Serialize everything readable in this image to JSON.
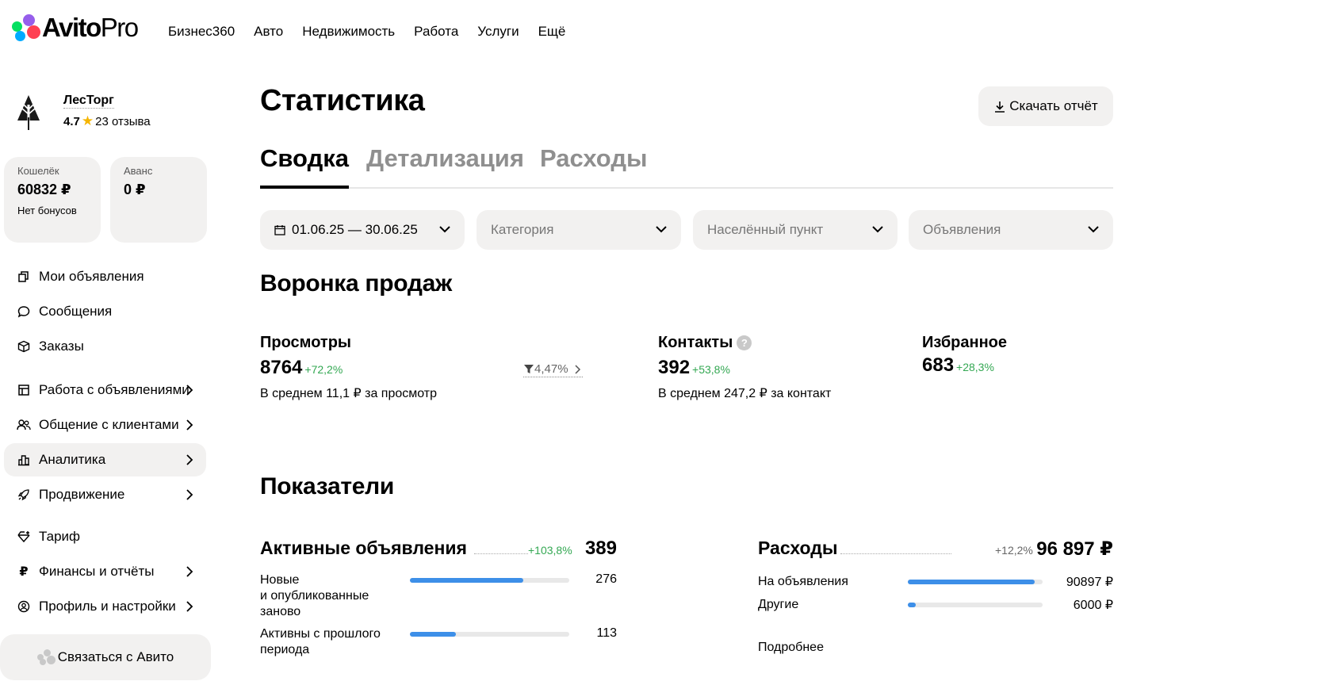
{
  "header": {
    "logo": {
      "avito": "Avito",
      "pro": "Pro"
    },
    "nav": [
      "Бизнес360",
      "Авто",
      "Недвижимость",
      "Работа",
      "Услуги",
      "Ещё"
    ]
  },
  "company": {
    "name": "ЛесТорг",
    "rating": "4.7",
    "reviews": "23 отзыва"
  },
  "wallets": [
    {
      "label": "Кошелёк",
      "value": "60832 ₽",
      "sub": "Нет бонусов"
    },
    {
      "label": "Аванс",
      "value": "0 ₽",
      "sub": ""
    }
  ],
  "menu": [
    {
      "label": "Мои объявления",
      "icon": "copy-icon",
      "chevron": false,
      "active": false
    },
    {
      "label": "Сообщения",
      "icon": "chat-icon",
      "chevron": false,
      "active": false
    },
    {
      "label": "Заказы",
      "icon": "box-icon",
      "chevron": false,
      "active": false
    },
    {
      "label": "Работа с объявлениями",
      "icon": "layout-icon",
      "chevron": true,
      "active": false
    },
    {
      "label": "Общение с клиентами",
      "icon": "users-icon",
      "chevron": true,
      "active": false
    },
    {
      "label": "Аналитика",
      "icon": "bar-chart-icon",
      "chevron": true,
      "active": true
    },
    {
      "label": "Продвижение",
      "icon": "rocket-icon",
      "chevron": true,
      "active": false
    },
    {
      "label": "Тариф",
      "icon": "diamond-icon",
      "chevron": false,
      "active": false
    },
    {
      "label": "Финансы и отчёты",
      "icon": "ruble-icon",
      "chevron": true,
      "active": false
    },
    {
      "label": "Профиль и настройки",
      "icon": "profile-icon",
      "chevron": true,
      "active": false
    }
  ],
  "contact_button": "Связаться с Авито",
  "page": {
    "title": "Статистика",
    "download_label": "Скачать отчёт"
  },
  "tabs": [
    "Сводка",
    "Детализация",
    "Расходы"
  ],
  "filters": {
    "date_range": "01.06.25 — 30.06.25",
    "category": "Категория",
    "city": "Населённый пункт",
    "ads": "Объявления"
  },
  "funnel": {
    "title": "Воронка продаж",
    "views": {
      "label": "Просмотры",
      "value": "8764",
      "delta": "+72,2%",
      "sub": "В среднем 11,1 ₽ за просмотр"
    },
    "conversion": "4,47%",
    "contacts": {
      "label": "Контакты",
      "value": "392",
      "delta": "+53,8%",
      "sub": "В среднем 247,2 ₽ за контакт"
    },
    "favorites": {
      "label": "Избранное",
      "value": "683",
      "delta": "+28,3%"
    }
  },
  "indicators": {
    "title": "Показатели",
    "active_ads": {
      "label": "Активные объявления",
      "delta": "+103,8%",
      "value": "389",
      "rows": [
        {
          "label": "Новые и опубликованные заново",
          "lines": [
            "Новые",
            "и опубликованные",
            "заново"
          ],
          "value": "276",
          "fraction": 0.71
        },
        {
          "label": "Активны с прошлого периода",
          "lines": [
            "Активны с прошлого",
            "периода"
          ],
          "value": "113",
          "fraction": 0.29
        }
      ]
    },
    "expenses": {
      "label": "Расходы",
      "delta": "+12,2%",
      "value": "96 897 ₽",
      "rows": [
        {
          "label": "На объявления",
          "value": "90897 ₽",
          "fraction": 0.94
        },
        {
          "label": "Другие",
          "value": "6000 ₽",
          "fraction": 0.06
        }
      ],
      "more": "Подробнее"
    }
  },
  "colors": {
    "accent_blue": "#3d8fe8",
    "positive_green": "#34a853",
    "surface": "#f2f1f0"
  }
}
